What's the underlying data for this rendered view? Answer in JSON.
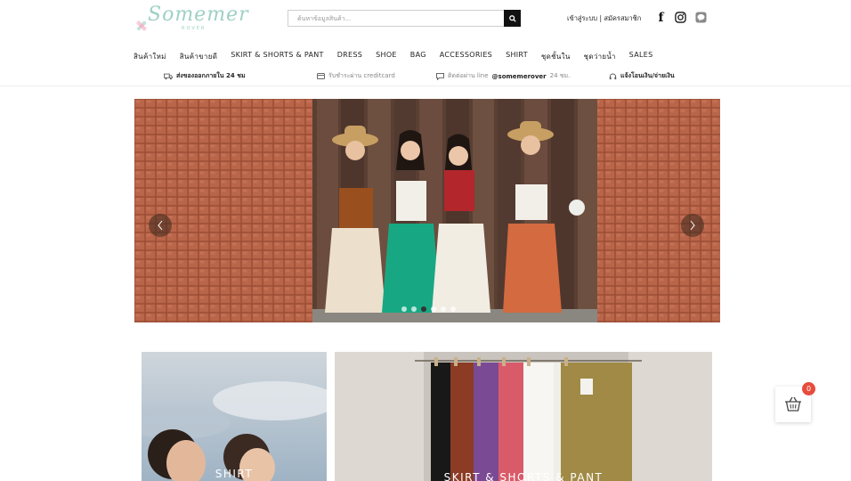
{
  "logo": {
    "text": "Somemer",
    "sub": "ROVER"
  },
  "search": {
    "placeholder": "ค้นหาข้อมูลสินค้า..."
  },
  "auth": {
    "login": "เข้าสู่ระบบ",
    "separator": "|",
    "register": "สมัครสมาชิก"
  },
  "social": {
    "facebook": "f",
    "facebook_icon": "facebook-icon",
    "instagram_icon": "instagram-icon",
    "line_icon": "line-icon"
  },
  "nav": [
    "สินค้าใหม่",
    "สินค้าขายดี",
    "SKIRT & SHORTS & PANT",
    "DRESS",
    "SHOE",
    "BAG",
    "ACCESSORIES",
    "SHIRT",
    "ชุดชั้นใน",
    "ชุดว่ายน้ำ",
    "SALES"
  ],
  "info": {
    "shipping": "ส่งของออกภายใน 24 ชม",
    "payment": "รับชำระผ่าน creditcard",
    "contact_prefix": "ติดต่อผ่าน line",
    "contact_id": "@somemerover",
    "contact_suffix": "24 ชม.",
    "notify": "แจ้งโอนเงิน/จ่ายเงิน"
  },
  "slider": {
    "dot_count": 6,
    "active_dot": 2
  },
  "tiles": {
    "shirt": "SHIRT",
    "skirt": "SKIRT & SHORTS & PANT"
  },
  "cart": {
    "count": "0"
  },
  "colors": {
    "accent": "#9fd0c4",
    "badge": "#e74c3c",
    "brick": "#a55a3c"
  }
}
